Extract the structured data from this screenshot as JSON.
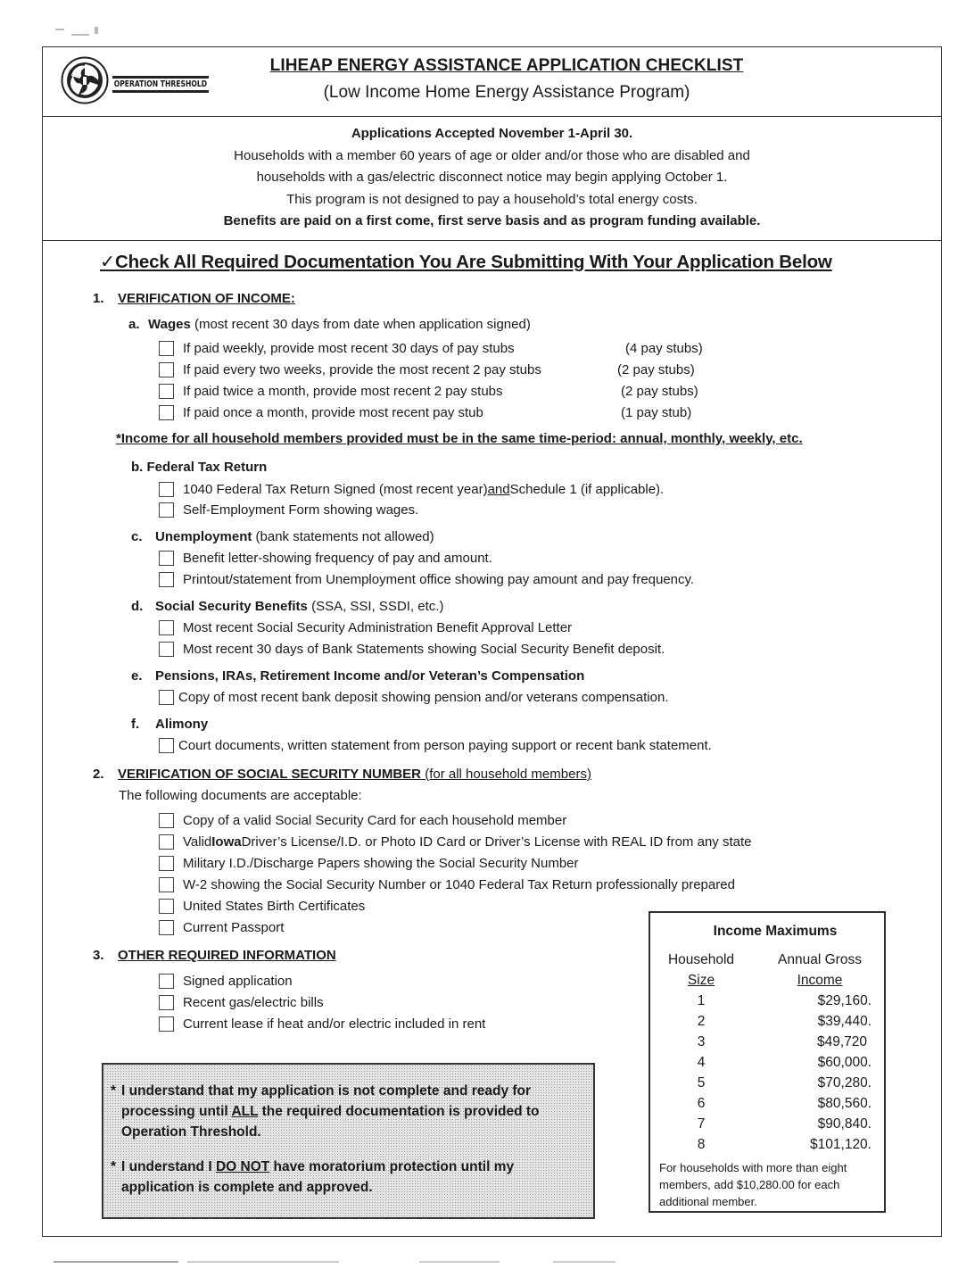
{
  "header": {
    "logo_text": "OPERATION THRESHOLD",
    "title": "LIHEAP ENERGY ASSISTANCE APPLICATION CHECKLIST",
    "subtitle": "(Low Income Home Energy Assistance Program)"
  },
  "notice": {
    "line1": "Applications Accepted November 1-April 30.",
    "line2": "Households with a member 60 years of age or older and/or those who are disabled and",
    "line3": "households with a gas/electric disconnect notice may begin applying October 1.",
    "line4": "This program is not designed to pay a household’s total energy costs.",
    "line5": "Benefits are paid on a first come, first serve basis and as program funding available."
  },
  "main_heading": {
    "check_glyph": "✓",
    "text": "Check All Required Documentation You Are Submitting With Your Application Below"
  },
  "section1": {
    "number": "1.",
    "title": "VERIFICATION OF INCOME:",
    "a": {
      "letter": "a.",
      "label": "Wages",
      "note": " (most recent 30 days from date when application signed)",
      "items": [
        {
          "text": "If paid weekly, provide most recent 30 days of pay stubs",
          "stubs": "(4 pay stubs)"
        },
        {
          "text": "If paid every two weeks, provide the most recent 2 pay stubs",
          "stubs": "(2 pay stubs)"
        },
        {
          "text": "If paid twice a month, provide most recent 2 pay stubs",
          "stubs": "(2 pay stubs)"
        },
        {
          "text": "If paid once a month, provide most recent pay stub",
          "stubs": "(1 pay stub)"
        }
      ]
    },
    "income_note": "*Income for all household members provided must be in the same time-period: annual, monthly, weekly, etc.",
    "b": {
      "letter": "b.",
      "label": "Federal Tax Return",
      "items": [
        {
          "pre": "1040 Federal Tax Return Signed (most recent year) ",
          "u": "and",
          "post": " Schedule 1 (if applicable)."
        },
        {
          "text": "Self-Employment Form showing wages."
        }
      ]
    },
    "c": {
      "letter": "c.",
      "label": "Unemployment",
      "note": " (bank statements not allowed)",
      "items": [
        "Benefit letter-showing frequency of pay and amount.",
        "Printout/statement from Unemployment office showing pay amount and pay frequency."
      ]
    },
    "d": {
      "letter": "d.",
      "label": "Social Security Benefits",
      "note": " (SSA, SSI, SSDI, etc.)",
      "items": [
        "Most recent Social Security Administration Benefit Approval Letter",
        "Most recent 30 days of Bank Statements showing Social Security Benefit deposit."
      ]
    },
    "e": {
      "letter": "e.",
      "label": "Pensions, IRAs, Retirement Income and/or Veteran’s Compensation",
      "items": [
        "Copy of most recent bank deposit showing pension and/or veterans compensation."
      ]
    },
    "f": {
      "letter": "f.",
      "label": "Alimony",
      "items": [
        "Court documents, written statement from person paying support or recent bank statement."
      ]
    }
  },
  "section2": {
    "number": "2.",
    "title": "VERIFICATION OF SOCIAL SECURITY NUMBER",
    "title_note": " (for all household members)",
    "intro": "The following documents are acceptable:",
    "items": [
      {
        "text": "Copy of a valid Social Security Card for each household member"
      },
      {
        "pre": "Valid ",
        "bold": "Iowa",
        "post": " Driver’s License/I.D. or Photo ID Card or Driver’s License with REAL ID from any state"
      },
      {
        "text": "Military I.D./Discharge Papers showing the Social Security Number"
      },
      {
        "text": "W-2 showing the Social Security Number or 1040 Federal Tax Return professionally prepared"
      },
      {
        "text": "United States Birth Certificates"
      },
      {
        "text": "Current Passport"
      }
    ]
  },
  "section3": {
    "number": "3.",
    "title": "OTHER REQUIRED INFORMATION",
    "items": [
      "Signed application",
      "Recent gas/electric bills",
      "Current lease if heat and/or electric included in rent"
    ]
  },
  "acknowledgements": [
    {
      "star": "*",
      "pre": "I understand that my application is not complete and ready for processing until ",
      "u": "ALL",
      "post": " the required documentation is provided to Operation Threshold."
    },
    {
      "star": "*",
      "pre": "I understand I ",
      "u": "DO NOT",
      "post": " have moratorium protection until my application is complete and approved."
    }
  ],
  "income_maximums": {
    "title": "Income Maximums",
    "col1_line1": "Household",
    "col1_line2": "Size",
    "col2_line1": "Annual Gross",
    "col2_line2": "Income",
    "rows": [
      {
        "size": "1",
        "amount": "$29,160."
      },
      {
        "size": "2",
        "amount": "$39,440."
      },
      {
        "size": "3",
        "amount": "$49,720"
      },
      {
        "size": "4",
        "amount": "$60,000."
      },
      {
        "size": "5",
        "amount": "$70,280."
      },
      {
        "size": "6",
        "amount": "$80,560."
      },
      {
        "size": "7",
        "amount": "$90,840."
      },
      {
        "size": "8",
        "amount": "$101,120."
      }
    ],
    "footnote": "For households with more than eight members, add $10,280.00 for each additional member."
  }
}
